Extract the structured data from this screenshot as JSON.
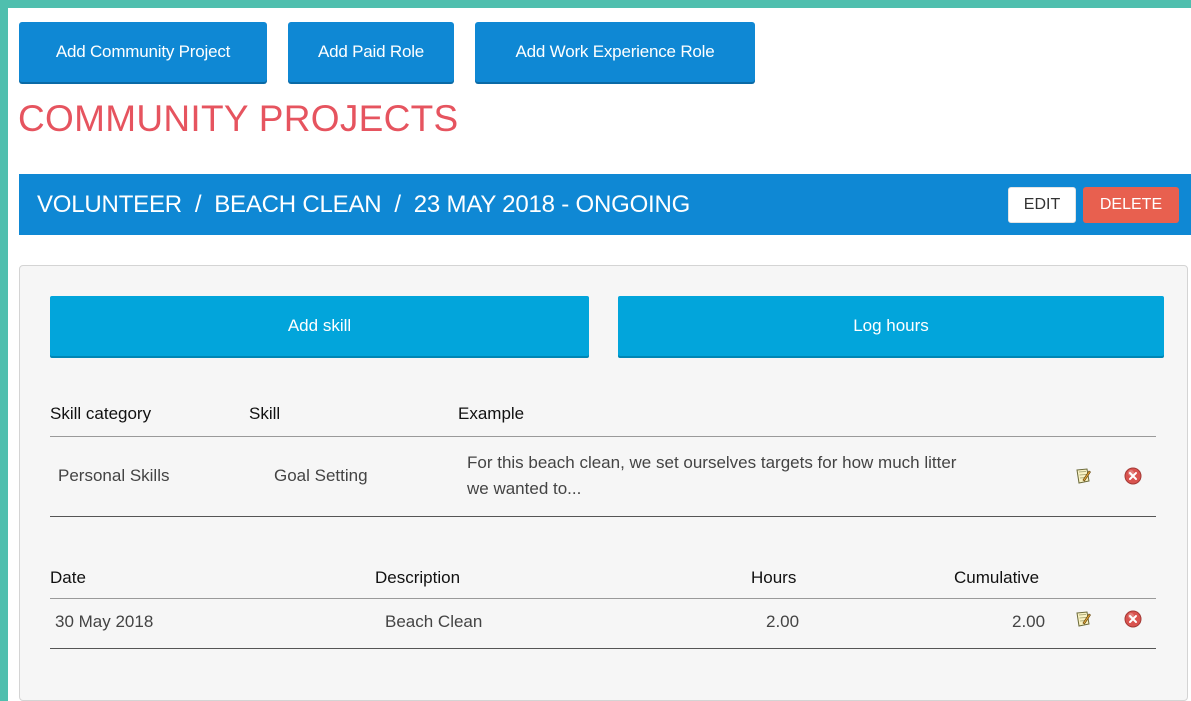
{
  "toolbar": {
    "add_community_project": "Add Community Project",
    "add_paid_role": "Add Paid Role",
    "add_work_experience_role": "Add Work Experience Role"
  },
  "section_title": "COMMUNITY PROJECTS",
  "project": {
    "heading": "VOLUNTEER  /  BEACH CLEAN  /  23 MAY 2018 - ONGOING",
    "edit_label": "EDIT",
    "delete_label": "DELETE"
  },
  "actions": {
    "add_skill": "Add skill",
    "log_hours": "Log hours"
  },
  "skills_table": {
    "headers": {
      "category": "Skill category",
      "skill": "Skill",
      "example": "Example"
    },
    "rows": [
      {
        "category": "Personal Skills",
        "skill": "Goal Setting",
        "example_line1": "For this beach clean, we set ourselves targets for how much litter",
        "example_line2": "we wanted to..."
      }
    ]
  },
  "hours_table": {
    "headers": {
      "date": "Date",
      "description": "Description",
      "hours": "Hours",
      "cumulative": "Cumulative"
    },
    "rows": [
      {
        "date": "30 May 2018",
        "description": "Beach Clean",
        "hours": "2.00",
        "cumulative": "2.00"
      }
    ]
  },
  "icons": {
    "edit": "edit-note-icon",
    "delete": "delete-circle-icon"
  },
  "colors": {
    "primary_blue": "#0f88d4",
    "light_blue": "#02a5db",
    "title_red": "#e6545f",
    "delete_red": "#e8604f",
    "frame_teal": "#4fbfae"
  }
}
